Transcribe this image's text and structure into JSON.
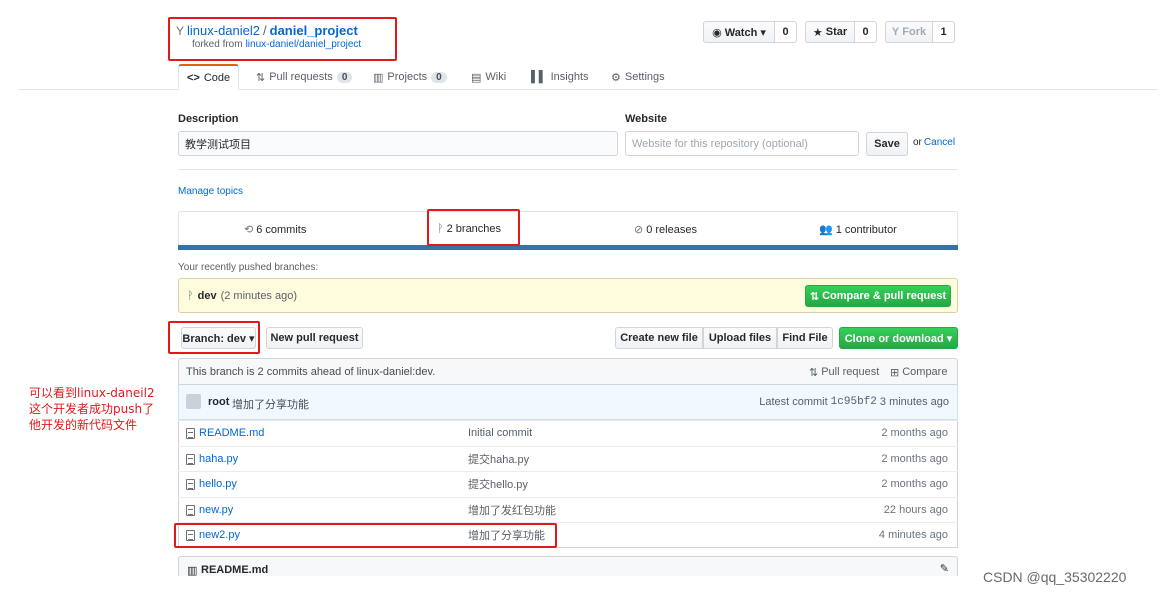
{
  "repo": {
    "owner": "linux-daniel2",
    "separator": "/",
    "name": "daniel_project",
    "forked_from_prefix": "forked from",
    "forked_from": "linux-daniel/daniel_project"
  },
  "actions": {
    "watch_label": "Watch ▾",
    "watch_count": "0",
    "star_label": "Star",
    "star_count": "0",
    "fork_label": "Fork",
    "fork_count": "1"
  },
  "tabs": [
    {
      "label": "Code",
      "icon": "code-icon"
    },
    {
      "label": "Pull requests",
      "count": "0",
      "icon": "pull-request-icon"
    },
    {
      "label": "Projects",
      "count": "0",
      "icon": "project-icon"
    },
    {
      "label": "Wiki",
      "icon": "book-icon"
    },
    {
      "label": "Insights",
      "icon": "graph-icon"
    },
    {
      "label": "Settings",
      "icon": "gear-icon"
    }
  ],
  "description": {
    "label": "Description",
    "value": "教学测试项目"
  },
  "website": {
    "label": "Website",
    "placeholder": "Website for this repository (optional)",
    "save_label": "Save",
    "or_text": "or",
    "cancel_label": "Cancel"
  },
  "manage_topics": "Manage topics",
  "summary": {
    "commits": "6 commits",
    "branches": "2 branches",
    "releases": "0 releases",
    "contributors": "1 contributor"
  },
  "pushed": {
    "heading": "Your recently pushed branches:",
    "branch": "dev",
    "time": "(2 minutes ago)",
    "compare_label": "Compare & pull request"
  },
  "toolbar": {
    "branch_label": "Branch: dev ▾",
    "new_pr_label": "New pull request",
    "create_file_label": "Create new file",
    "upload_label": "Upload files",
    "find_label": "Find File",
    "clone_label": "Clone or download ▾"
  },
  "ahead": {
    "text": "This branch is 2 commits ahead of linux-daniel:dev.",
    "pr_label": "Pull request",
    "compare_label": "Compare"
  },
  "latest_commit": {
    "author": "root",
    "message": "增加了分享功能",
    "prefix": "Latest commit",
    "sha": "1c95bf2",
    "time": "3 minutes ago"
  },
  "files": [
    {
      "name": "README.md",
      "message": "Initial commit",
      "age": "2 months ago"
    },
    {
      "name": "haha.py",
      "message": "提交haha.py",
      "age": "2 months ago"
    },
    {
      "name": "hello.py",
      "message": "提交hello.py",
      "age": "2 months ago"
    },
    {
      "name": "new.py",
      "message": "增加了发红包功能",
      "age": "22 hours ago"
    },
    {
      "name": "new2.py",
      "message": "增加了分享功能",
      "age": "4 minutes ago"
    }
  ],
  "readme_header": "README.md",
  "annotation": {
    "line1": "可以看到linux-daneil2",
    "line2": "这个开发者成功push了",
    "line3": "他开发的新代码文件"
  },
  "watermark": "CSDN @qq_35302220",
  "colors": {
    "link": "#0366d6",
    "accent_green": "#28a745",
    "highlight_red": "#e0191c",
    "lang_bar": "#3572a5"
  }
}
